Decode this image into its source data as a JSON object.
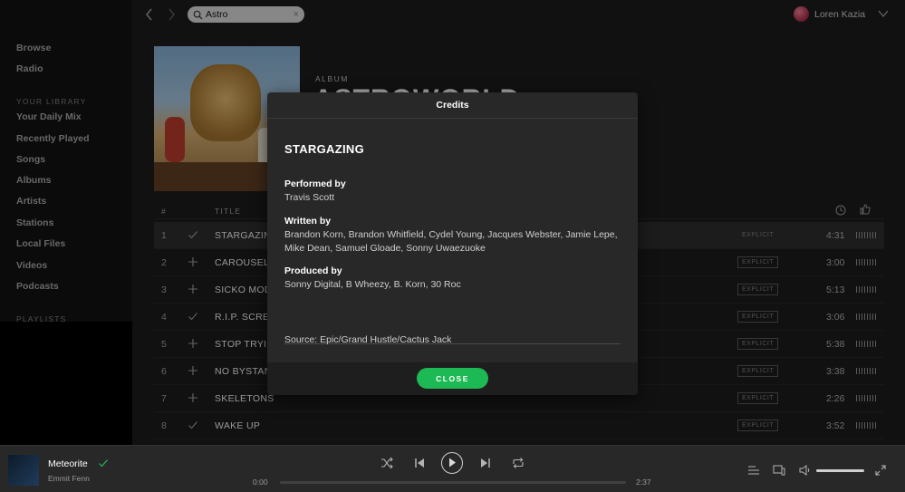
{
  "sidebar": {
    "nav": [
      "Browse",
      "Radio"
    ],
    "library_title": "YOUR LIBRARY",
    "library": [
      "Your Daily Mix",
      "Recently Played",
      "Songs",
      "Albums",
      "Artists",
      "Stations",
      "Local Files",
      "Videos",
      "Podcasts"
    ],
    "playlists_title": "PLAYLISTS"
  },
  "topbar": {
    "search_value": "Astro",
    "user_name": "Loren Kazia"
  },
  "album": {
    "type": "ALBUM",
    "title": "ASTROWORLD"
  },
  "tracks": {
    "header": {
      "num": "#",
      "title": "TITLE"
    },
    "rows": [
      {
        "num": "1",
        "title": "STARGAZING",
        "saved": true,
        "explicit": "EXPLICIT",
        "duration": "4:31"
      },
      {
        "num": "2",
        "title": "CAROUSEL",
        "saved": false,
        "explicit": "EXPLICIT",
        "duration": "3:00"
      },
      {
        "num": "3",
        "title": "SICKO MODE",
        "saved": false,
        "explicit": "EXPLICIT",
        "duration": "5:13"
      },
      {
        "num": "4",
        "title": "R.I.P. SCREW",
        "saved": true,
        "explicit": "EXPLICIT",
        "duration": "3:06"
      },
      {
        "num": "5",
        "title": "STOP TRYING TO BE GOD",
        "saved": false,
        "explicit": "EXPLICIT",
        "duration": "5:38"
      },
      {
        "num": "6",
        "title": "NO BYSTANDERS",
        "saved": false,
        "explicit": "EXPLICIT",
        "duration": "3:38"
      },
      {
        "num": "7",
        "title": "SKELETONS",
        "saved": false,
        "explicit": "EXPLICIT",
        "duration": "2:26"
      },
      {
        "num": "8",
        "title": "WAKE UP",
        "saved": true,
        "explicit": "EXPLICIT",
        "duration": "3:52"
      }
    ]
  },
  "modal": {
    "header": "Credits",
    "track_name": "STARGAZING",
    "performed_label": "Performed by",
    "performed_value": "Travis Scott",
    "written_label": "Written by",
    "written_value": "Brandon Korn, Brandon Whitfield, Cydel Young, Jacques Webster, Jamie Lepe, Mike Dean, Samuel Gloade, Sonny Uwaezuoke",
    "produced_label": "Produced by",
    "produced_value": "Sonny Digital, B Wheezy, B. Korn, 30 Roc",
    "source": "Source: Epic/Grand Hustle/Cactus Jack",
    "close_label": "CLOSE"
  },
  "player": {
    "title": "Meteorite",
    "artist": "Emmit Fenn",
    "time_current": "0:00",
    "time_total": "2:37",
    "progress": 0.0,
    "volume": 1.0
  },
  "colors": {
    "accent": "#1db954",
    "background": "#121212",
    "panel": "#282828"
  }
}
